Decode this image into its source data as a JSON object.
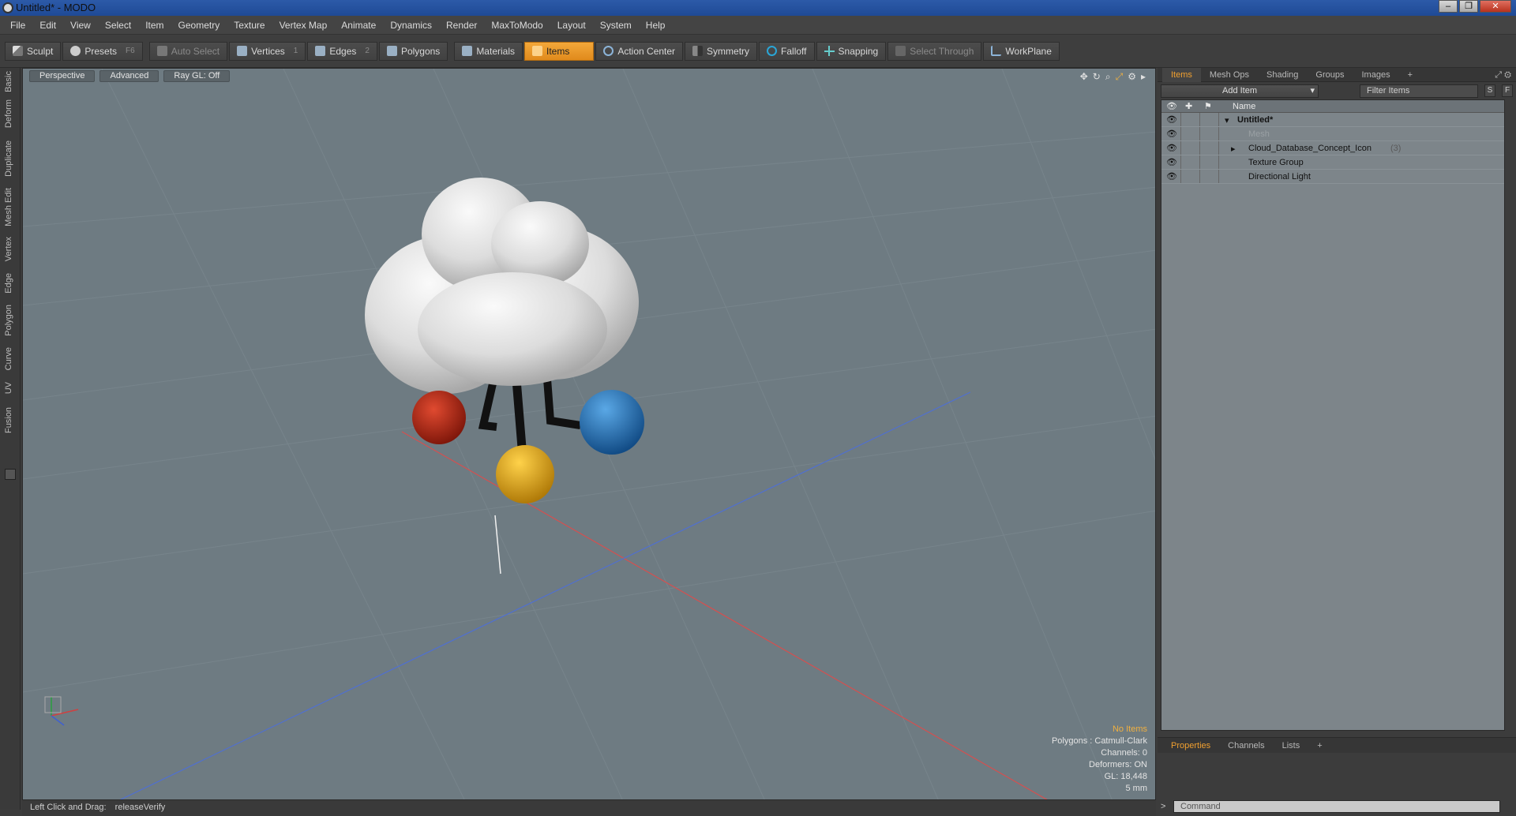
{
  "window": {
    "title": "Untitled* - MODO"
  },
  "menu": [
    "File",
    "Edit",
    "View",
    "Select",
    "Item",
    "Geometry",
    "Texture",
    "Vertex Map",
    "Animate",
    "Dynamics",
    "Render",
    "MaxToModo",
    "Layout",
    "System",
    "Help"
  ],
  "toolbar": {
    "sculpt": "Sculpt",
    "presets": "Presets",
    "presets_key": "F6",
    "auto_select": "Auto Select",
    "vertices": "Vertices",
    "vertices_key": "1",
    "edges": "Edges",
    "edges_key": "2",
    "polygons": "Polygons",
    "materials": "Materials",
    "items": "Items",
    "action_center": "Action Center",
    "symmetry": "Symmetry",
    "falloff": "Falloff",
    "snapping": "Snapping",
    "select_through": "Select Through",
    "workplane": "WorkPlane"
  },
  "left_tabs": [
    "Basic",
    "Deform",
    "Duplicate",
    "Mesh Edit",
    "Vertex",
    "Edge",
    "Polygon",
    "Curve",
    "UV",
    "Fusion"
  ],
  "viewport": {
    "view": "Perspective",
    "shading": "Advanced",
    "raygl": "Ray GL: Off",
    "info": {
      "selection": "No Items",
      "polygons": "Polygons : Catmull-Clark",
      "channels": "Channels: 0",
      "deformers": "Deformers: ON",
      "gl": "GL: 18,448",
      "unit": "5 mm"
    }
  },
  "status": {
    "hint": "Left Click and Drag:",
    "action": "releaseVerify"
  },
  "right_panel": {
    "tabs": [
      "Items",
      "Mesh Ops",
      "Shading",
      "Groups",
      "Images"
    ],
    "add_item": "Add Item",
    "filter": "Filter Items",
    "s_btn": "S",
    "f_btn": "F",
    "name_col": "Name",
    "tree": [
      {
        "label": "Untitled*",
        "count": ""
      },
      {
        "label": "Mesh",
        "count": ""
      },
      {
        "label": "Cloud_Database_Concept_Icon",
        "count": "(3)"
      },
      {
        "label": "Texture Group",
        "count": ""
      },
      {
        "label": "Directional Light",
        "count": ""
      }
    ],
    "bottom_tabs": [
      "Properties",
      "Channels",
      "Lists"
    ],
    "command_placeholder": "Command"
  },
  "colors": {
    "accent": "#f0a030",
    "viewport_bg": "#6e7b82",
    "red_sphere": "#b02a1a",
    "blue_sphere": "#1f6cb0",
    "yellow_sphere": "#e8b020",
    "cloud": "#e6e6e6"
  }
}
